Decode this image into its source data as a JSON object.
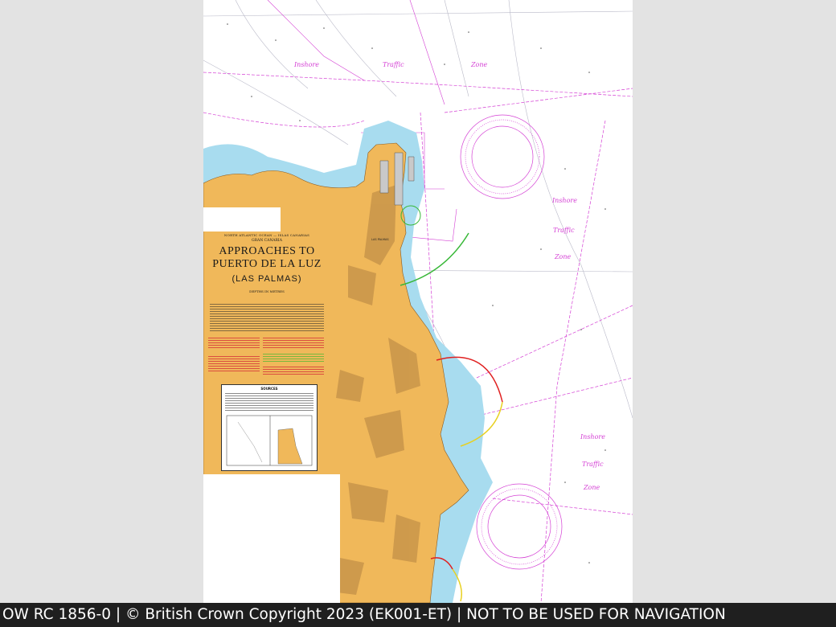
{
  "chart": {
    "region_line": "NORTH ATLANTIC OCEAN — ISLAS CANARIAS",
    "island": "GRAN CANARIA",
    "title_line1": "APPROACHES TO",
    "title_line2": "PUERTO DE LA LUZ",
    "subtitle": "(LAS PALMAS)",
    "depths": "DEPTHS IN METRES",
    "sources_title": "SOURCES",
    "port_label": "LAS PALMAS"
  },
  "traffic_zones": [
    {
      "w1": "Inshore",
      "w2": "Traffic",
      "w3": "Zone"
    },
    {
      "w1": "Inshore",
      "w2": "Traffic",
      "w3": "Zone"
    },
    {
      "w1": "Inshore",
      "w2": "Traffic",
      "w3": "Zone"
    }
  ],
  "colors": {
    "land": "#f0b85a",
    "land_dark": "#c9954a",
    "shallow_water": "#a8dcef",
    "deep_water": "#ffffff",
    "magenta": "#d43fd4",
    "sector_red": "#e02020",
    "sector_green": "#38b838",
    "sector_yellow": "#e8d020"
  },
  "footer": {
    "text": "OW RC 1856-0 | © British Crown Copyright 2023 (EK001-ET) | NOT TO BE USED FOR NAVIGATION"
  }
}
